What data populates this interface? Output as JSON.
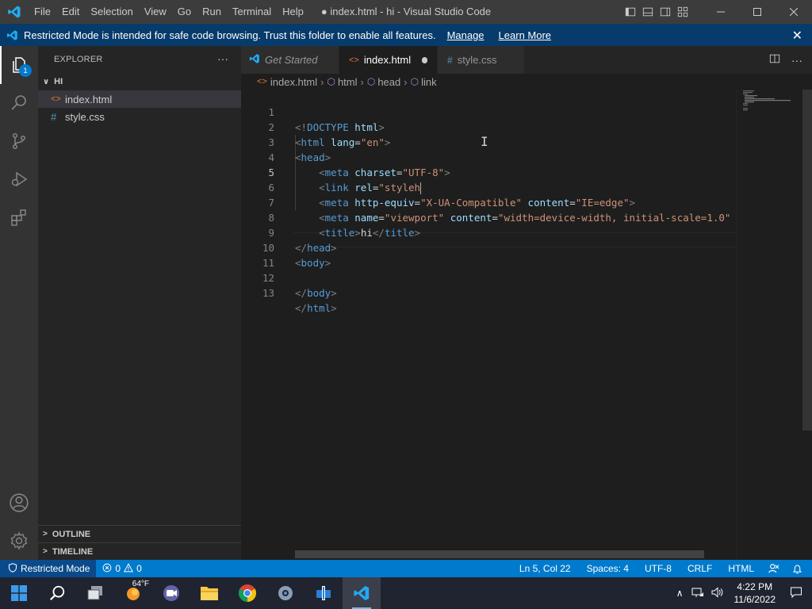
{
  "window": {
    "title": "● index.html - hi - Visual Studio Code",
    "menu": [
      "File",
      "Edit",
      "Selection",
      "View",
      "Go",
      "Run",
      "Terminal",
      "Help"
    ]
  },
  "banner": {
    "message": "Restricted Mode is intended for safe code browsing. Trust this folder to enable all features.",
    "manage_link": "Manage",
    "learn_more_link": "Learn More"
  },
  "activity_bar": {
    "explorer_badge": "1",
    "items": [
      "explorer-icon",
      "search-icon",
      "source-control-icon",
      "run-debug-icon",
      "extensions-icon"
    ],
    "bottom_items": [
      "account-icon",
      "manage-gear-icon"
    ]
  },
  "sidebar": {
    "title": "EXPLORER",
    "more": "···",
    "folder": "HI",
    "files": [
      {
        "icon": "<>",
        "name": "index.html",
        "selected": true
      },
      {
        "icon": "#",
        "name": "style.css",
        "selected": false
      }
    ],
    "outline": "OUTLINE",
    "timeline": "TIMELINE"
  },
  "tabs": [
    {
      "label": "Get Started",
      "active": false
    },
    {
      "label": "index.html",
      "active": true,
      "dirty": true
    },
    {
      "label": "style.css",
      "active": false
    }
  ],
  "breadcrumb": [
    "index.html",
    "html",
    "head",
    "link"
  ],
  "editor": {
    "current_line": 5,
    "line_numbers": [
      "1",
      "2",
      "3",
      "4",
      "5",
      "6",
      "7",
      "8",
      "9",
      "10",
      "11",
      "12",
      "13"
    ]
  },
  "statusbar": {
    "restricted": "Restricted Mode",
    "errors": "0",
    "warnings": "0",
    "position": "Ln 5, Col 22",
    "spaces": "Spaces: 4",
    "encoding": "UTF-8",
    "eol": "CRLF",
    "language": "HTML"
  },
  "taskbar": {
    "weather": "64°F",
    "time": "4:22 PM",
    "date": "11/6/2022"
  },
  "colors": {
    "accent": "#007acc",
    "banner": "#063b6b",
    "titlebar": "#3c3c3c"
  }
}
